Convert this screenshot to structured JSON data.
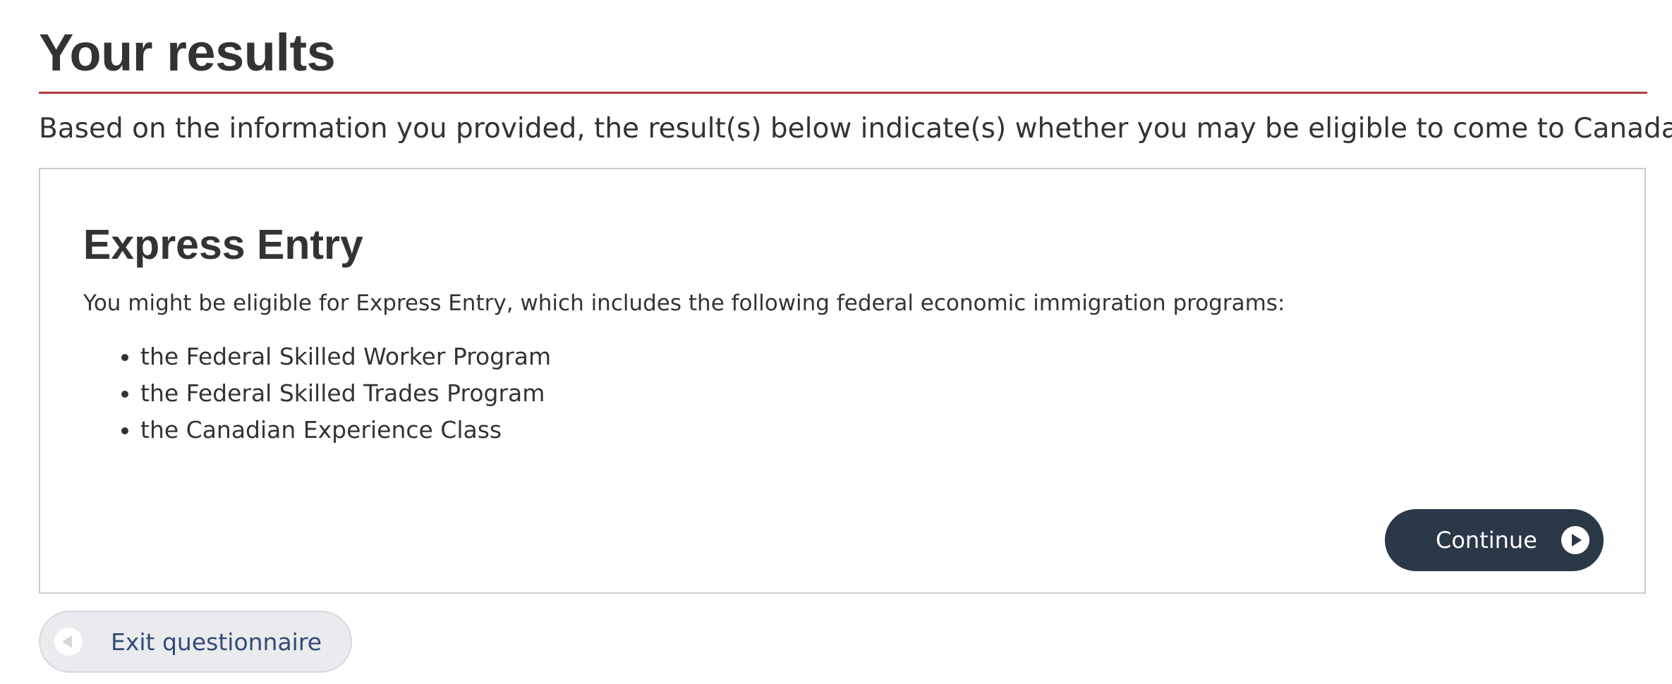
{
  "header": {
    "title": "Your results",
    "intro": "Based on the information you provided, the result(s) below indicate(s) whether you may be eligible to come to Canada."
  },
  "result": {
    "title": "Express Entry",
    "description": "You might be eligible for Express Entry, which includes the following federal economic immigration programs:",
    "programs": [
      "the Federal Skilled Worker Program",
      "the Federal Skilled Trades Program",
      "the Canadian Experience Class"
    ],
    "continue_label": "Continue",
    "continue_icon": "play-circle-icon"
  },
  "footer": {
    "exit_label": "Exit questionnaire",
    "exit_icon": "back-circle-icon"
  },
  "colors": {
    "title_rule": "#af3c43",
    "continue_bg": "#2b3847",
    "exit_bg": "#e9ebee",
    "exit_text": "#334a75",
    "card_border": "#cccccc"
  }
}
